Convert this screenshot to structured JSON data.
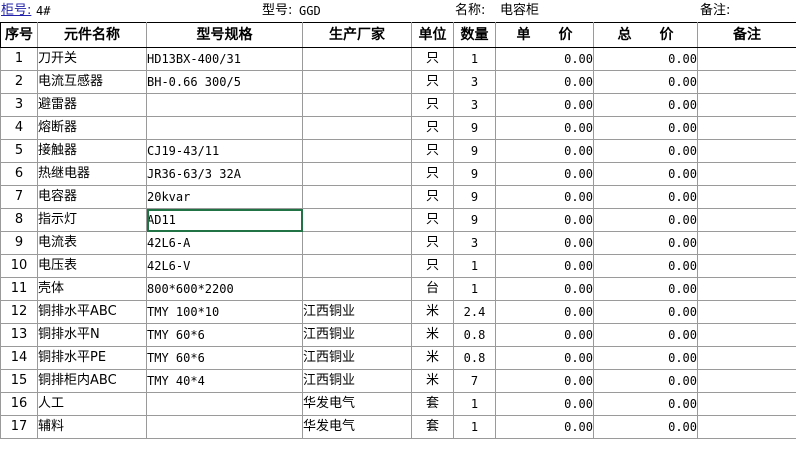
{
  "header": {
    "cabinet_label": "柜号:",
    "cabinet_value": "4#",
    "model_label": "型号:",
    "model_value": "GGD",
    "name_label": "名称:",
    "name_value": "电容柜",
    "remark_label": "备注:"
  },
  "columns": {
    "seq": "序号",
    "name": "元件名称",
    "model": "型号规格",
    "maker": "生产厂家",
    "unit": "单位",
    "qty": "数量",
    "unit_price": "单　　价",
    "total_price": "总　　价",
    "remark": "备注"
  },
  "selected_row": 7,
  "rows": [
    {
      "seq": "1",
      "name": "刀开关",
      "model": "HD13BX-400/31",
      "maker": "",
      "unit": "只",
      "qty": "1",
      "unit_price": "0.00",
      "total_price": "0.00",
      "remark": ""
    },
    {
      "seq": "2",
      "name": "电流互感器",
      "model": "BH-0.66 300/5",
      "maker": "",
      "unit": "只",
      "qty": "3",
      "unit_price": "0.00",
      "total_price": "0.00",
      "remark": ""
    },
    {
      "seq": "3",
      "name": "避雷器",
      "model": "",
      "maker": "",
      "unit": "只",
      "qty": "3",
      "unit_price": "0.00",
      "total_price": "0.00",
      "remark": ""
    },
    {
      "seq": "4",
      "name": "熔断器",
      "model": "",
      "maker": "",
      "unit": "只",
      "qty": "9",
      "unit_price": "0.00",
      "total_price": "0.00",
      "remark": ""
    },
    {
      "seq": "5",
      "name": "接触器",
      "model": "CJ19-43/11",
      "maker": "",
      "unit": "只",
      "qty": "9",
      "unit_price": "0.00",
      "total_price": "0.00",
      "remark": ""
    },
    {
      "seq": "6",
      "name": "热继电器",
      "model": "JR36-63/3 32A",
      "maker": "",
      "unit": "只",
      "qty": "9",
      "unit_price": "0.00",
      "total_price": "0.00",
      "remark": ""
    },
    {
      "seq": "7",
      "name": "电容器",
      "model": "20kvar",
      "maker": "",
      "unit": "只",
      "qty": "9",
      "unit_price": "0.00",
      "total_price": "0.00",
      "remark": ""
    },
    {
      "seq": "8",
      "name": "指示灯",
      "model": "AD11",
      "maker": "",
      "unit": "只",
      "qty": "9",
      "unit_price": "0.00",
      "total_price": "0.00",
      "remark": ""
    },
    {
      "seq": "9",
      "name": "电流表",
      "model": "42L6-A",
      "maker": "",
      "unit": "只",
      "qty": "3",
      "unit_price": "0.00",
      "total_price": "0.00",
      "remark": ""
    },
    {
      "seq": "10",
      "name": "电压表",
      "model": "42L6-V",
      "maker": "",
      "unit": "只",
      "qty": "1",
      "unit_price": "0.00",
      "total_price": "0.00",
      "remark": ""
    },
    {
      "seq": "11",
      "name": "壳体",
      "model": "800*600*2200",
      "maker": "",
      "unit": "台",
      "qty": "1",
      "unit_price": "0.00",
      "total_price": "0.00",
      "remark": ""
    },
    {
      "seq": "12",
      "name": "铜排水平ABC",
      "model": "TMY 100*10",
      "maker": "江西铜业",
      "unit": "米",
      "qty": "2.4",
      "unit_price": "0.00",
      "total_price": "0.00",
      "remark": ""
    },
    {
      "seq": "13",
      "name": "铜排水平N",
      "model": "TMY 60*6",
      "maker": "江西铜业",
      "unit": "米",
      "qty": "0.8",
      "unit_price": "0.00",
      "total_price": "0.00",
      "remark": ""
    },
    {
      "seq": "14",
      "name": "铜排水平PE",
      "model": "TMY 60*6",
      "maker": "江西铜业",
      "unit": "米",
      "qty": "0.8",
      "unit_price": "0.00",
      "total_price": "0.00",
      "remark": ""
    },
    {
      "seq": "15",
      "name": "铜排柜内ABC",
      "model": "TMY 40*4",
      "maker": "江西铜业",
      "unit": "米",
      "qty": "7",
      "unit_price": "0.00",
      "total_price": "0.00",
      "remark": ""
    },
    {
      "seq": "16",
      "name": "人工",
      "model": "",
      "maker": "华发电气",
      "unit": "套",
      "qty": "1",
      "unit_price": "0.00",
      "total_price": "0.00",
      "remark": ""
    },
    {
      "seq": "17",
      "name": "辅料",
      "model": "",
      "maker": "华发电气",
      "unit": "套",
      "qty": "1",
      "unit_price": "0.00",
      "total_price": "0.00",
      "remark": ""
    }
  ]
}
